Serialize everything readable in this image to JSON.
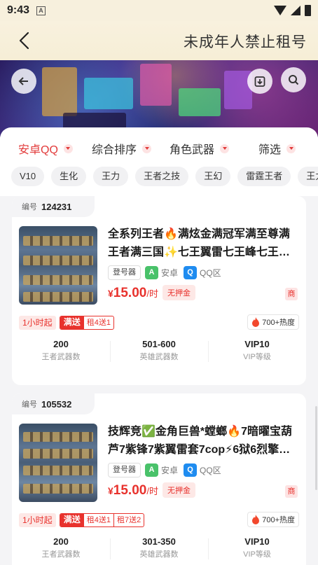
{
  "status_bar": {
    "time": "9:43",
    "notification_icon": "A"
  },
  "header": {
    "title": "未成年人禁止租号"
  },
  "filters": {
    "sort_options": [
      {
        "label": "安卓QQ",
        "active": true
      },
      {
        "label": "综合排序",
        "active": false
      },
      {
        "label": "角色武器",
        "active": false
      },
      {
        "label": "筛选",
        "active": false
      }
    ],
    "tags": [
      "V10",
      "生化",
      "王力",
      "王者之技",
      "王幻",
      "雷霆王者",
      "王力紫"
    ]
  },
  "listings": [
    {
      "code_label": "编号",
      "code": "124231",
      "title": "全系列王者🔥满炫金满冠军满至尊满王者满三国✨七王翼雷七王峰七王…",
      "login_label": "登号器",
      "platform": "安卓",
      "region": "QQ区",
      "price_symbol": "¥",
      "price": "15.00",
      "price_unit": "/时",
      "deposit": "无押金",
      "shop_badge": "商",
      "min_rent": "1小时起",
      "deal_label": "满送",
      "deals": [
        "租4送1"
      ],
      "heat": "700+热度",
      "stats": [
        {
          "value": "200",
          "label": "王者武器数"
        },
        {
          "value": "501-600",
          "label": "英雄武器数"
        },
        {
          "value": "VIP10",
          "label": "VIP等级"
        }
      ]
    },
    {
      "code_label": "编号",
      "code": "105532",
      "title": "技辉竞✅金角巨兽*螳螂🔥7暗曜宝葫芦7紫锋7紫翼雷套7cop⚡6狱6烈擎…",
      "login_label": "登号器",
      "platform": "安卓",
      "region": "QQ区",
      "price_symbol": "¥",
      "price": "15.00",
      "price_unit": "/时",
      "deposit": "无押金",
      "shop_badge": "商",
      "min_rent": "1小时起",
      "deal_label": "满送",
      "deals": [
        "租4送1",
        "租7送2"
      ],
      "heat": "700+热度",
      "stats": [
        {
          "value": "200",
          "label": "王者武器数"
        },
        {
          "value": "301-350",
          "label": "英雄武器数"
        },
        {
          "value": "VIP10",
          "label": "VIP等级"
        }
      ]
    }
  ],
  "colors": {
    "accent": "#e8322d",
    "header_bg": "#f7f0dd"
  },
  "icons": [
    "back-arrow-icon",
    "circle-back-icon",
    "save-icon",
    "search-icon",
    "android-icon",
    "qq-icon",
    "flame-icon"
  ]
}
